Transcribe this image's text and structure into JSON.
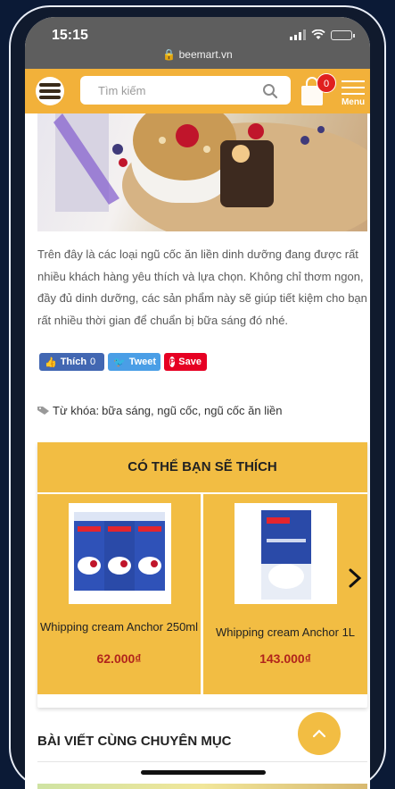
{
  "status_bar": {
    "time": "15:15",
    "url": "beemart.vn"
  },
  "header": {
    "search_placeholder": "Tìm kiếm",
    "cart_count": "0",
    "menu_label": "Menu"
  },
  "article": {
    "paragraph": "Trên đây là các loại ngũ cốc ăn liền dinh dưỡng đang được rất nhiều khách hàng yêu thích và lựa chọn. Không chỉ thơm ngon, đầy đủ dinh dưỡng, các sản phẩm này sẽ giúp tiết kiệm cho bạn rất nhiều thời gian để chuẩn bị bữa sáng đó nhé."
  },
  "social": {
    "like_label": "Thích",
    "like_count": "0",
    "tweet_label": "Tweet",
    "save_label": "Save"
  },
  "tags": {
    "label": "Từ khóa:",
    "items": "bữa sáng, ngũ cốc, ngũ cốc ăn liền"
  },
  "recommend": {
    "title": "CÓ THỂ BẠN SẼ THÍCH",
    "products": [
      {
        "name": "Whipping cream Anchor 250ml",
        "price": "62.000₫"
      },
      {
        "name": "Whipping cream Anchor 1L",
        "price": "143.000₫"
      }
    ]
  },
  "related": {
    "title": "BÀI VIẾT CÙNG CHUYÊN MỤC"
  },
  "colors": {
    "brand": "#f2b13a",
    "price": "#b1241c",
    "facebook": "#4267b2",
    "twitter": "#4a9ee6",
    "pinterest": "#e60023"
  }
}
